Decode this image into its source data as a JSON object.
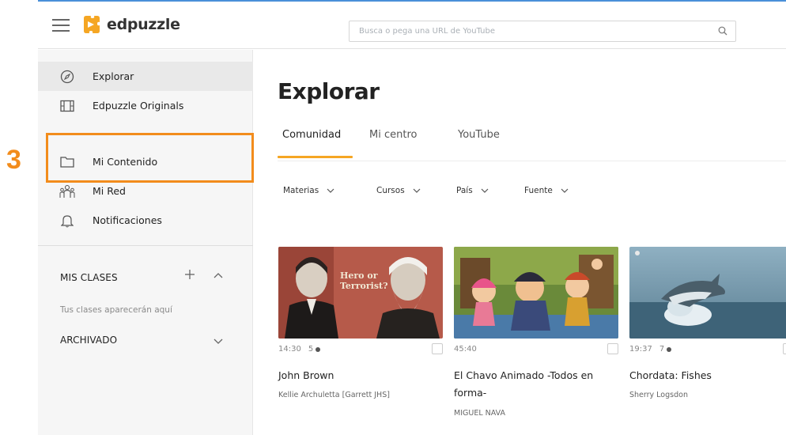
{
  "app": {
    "brand": "edpuzzle",
    "accent_color": "#f5a623"
  },
  "search": {
    "placeholder": "Busca o pega una URL de YouTube",
    "icon": "search-icon"
  },
  "sidebar": {
    "items": [
      {
        "label": "Explorar",
        "icon": "compass-icon",
        "active": true
      },
      {
        "label": "Edpuzzle Originals",
        "icon": "film-icon",
        "active": false
      },
      {
        "label": "Mi Contenido",
        "icon": "folder-icon",
        "active": false
      },
      {
        "label": "Mi Red",
        "icon": "network-icon",
        "active": false
      },
      {
        "label": "Notificaciones",
        "icon": "bell-icon",
        "active": false
      }
    ],
    "classes_title": "MIS CLASES",
    "classes_hint": "Tus clases aparecerán aquí",
    "archived_title": "ARCHIVADO"
  },
  "main": {
    "title": "Explorar",
    "tabs": [
      {
        "label": "Comunidad"
      },
      {
        "label": "Mi centro"
      },
      {
        "label": "YouTube"
      }
    ],
    "filters": [
      {
        "label": "Materias"
      },
      {
        "label": "Cursos"
      },
      {
        "label": "País"
      },
      {
        "label": "Fuente"
      }
    ],
    "cards": [
      {
        "duration": "14:30",
        "questions": "5",
        "title": "John Brown",
        "author": "Kellie Archuletta [Garrett JHS]",
        "thumb_text": "Hero or Terrorist?"
      },
      {
        "duration": "45:40",
        "questions": "",
        "title": "El Chavo Animado -Todos en forma-",
        "author": "MIGUEL NAVA"
      },
      {
        "duration": "19:37",
        "questions": "7",
        "title": "Chordata: Fishes",
        "author": "Sherry Logsdon"
      }
    ]
  },
  "annotation": {
    "number": "3",
    "color": "#f28c1c"
  }
}
